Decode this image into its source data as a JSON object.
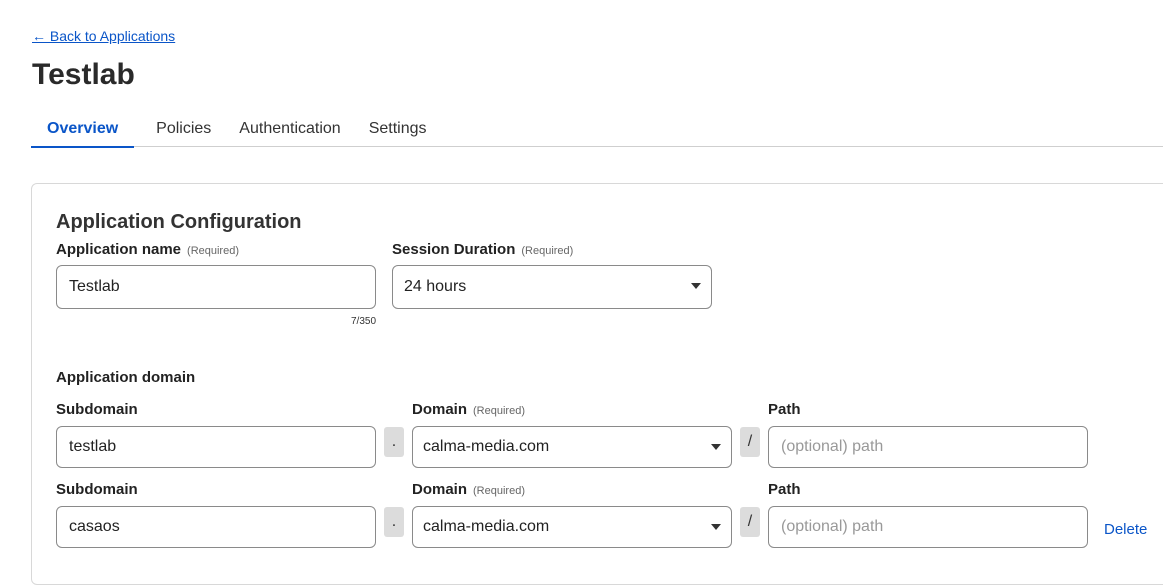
{
  "nav": {
    "back_label": "← Back to Applications"
  },
  "page": {
    "title": "Testlab"
  },
  "tabs": [
    {
      "label": "Overview",
      "active": true
    },
    {
      "label": "Policies"
    },
    {
      "label": "Authentication"
    },
    {
      "label": "Settings"
    }
  ],
  "config": {
    "section_title": "Application Configuration",
    "required_text": "(Required)",
    "app_name": {
      "label": "Application name",
      "value": "Testlab",
      "counter": "7/350"
    },
    "session": {
      "label": "Session Duration",
      "value": "24 hours"
    },
    "domain_heading": "Application domain",
    "rows": [
      {
        "subdomain_label": "Subdomain",
        "subdomain": "testlab",
        "dot": ".",
        "domain_label": "Domain",
        "domain": "calma-media.com",
        "slash": "/",
        "path_label": "Path",
        "path_placeholder": "(optional) path"
      },
      {
        "subdomain_label": "Subdomain",
        "subdomain": "casaos",
        "dot": ".",
        "domain_label": "Domain",
        "domain": "calma-media.com",
        "slash": "/",
        "path_label": "Path",
        "path_placeholder": "(optional) path",
        "delete_label": "Delete"
      }
    ]
  },
  "colors": {
    "accent": "#0a55c8",
    "border": "#8a8a8a"
  }
}
